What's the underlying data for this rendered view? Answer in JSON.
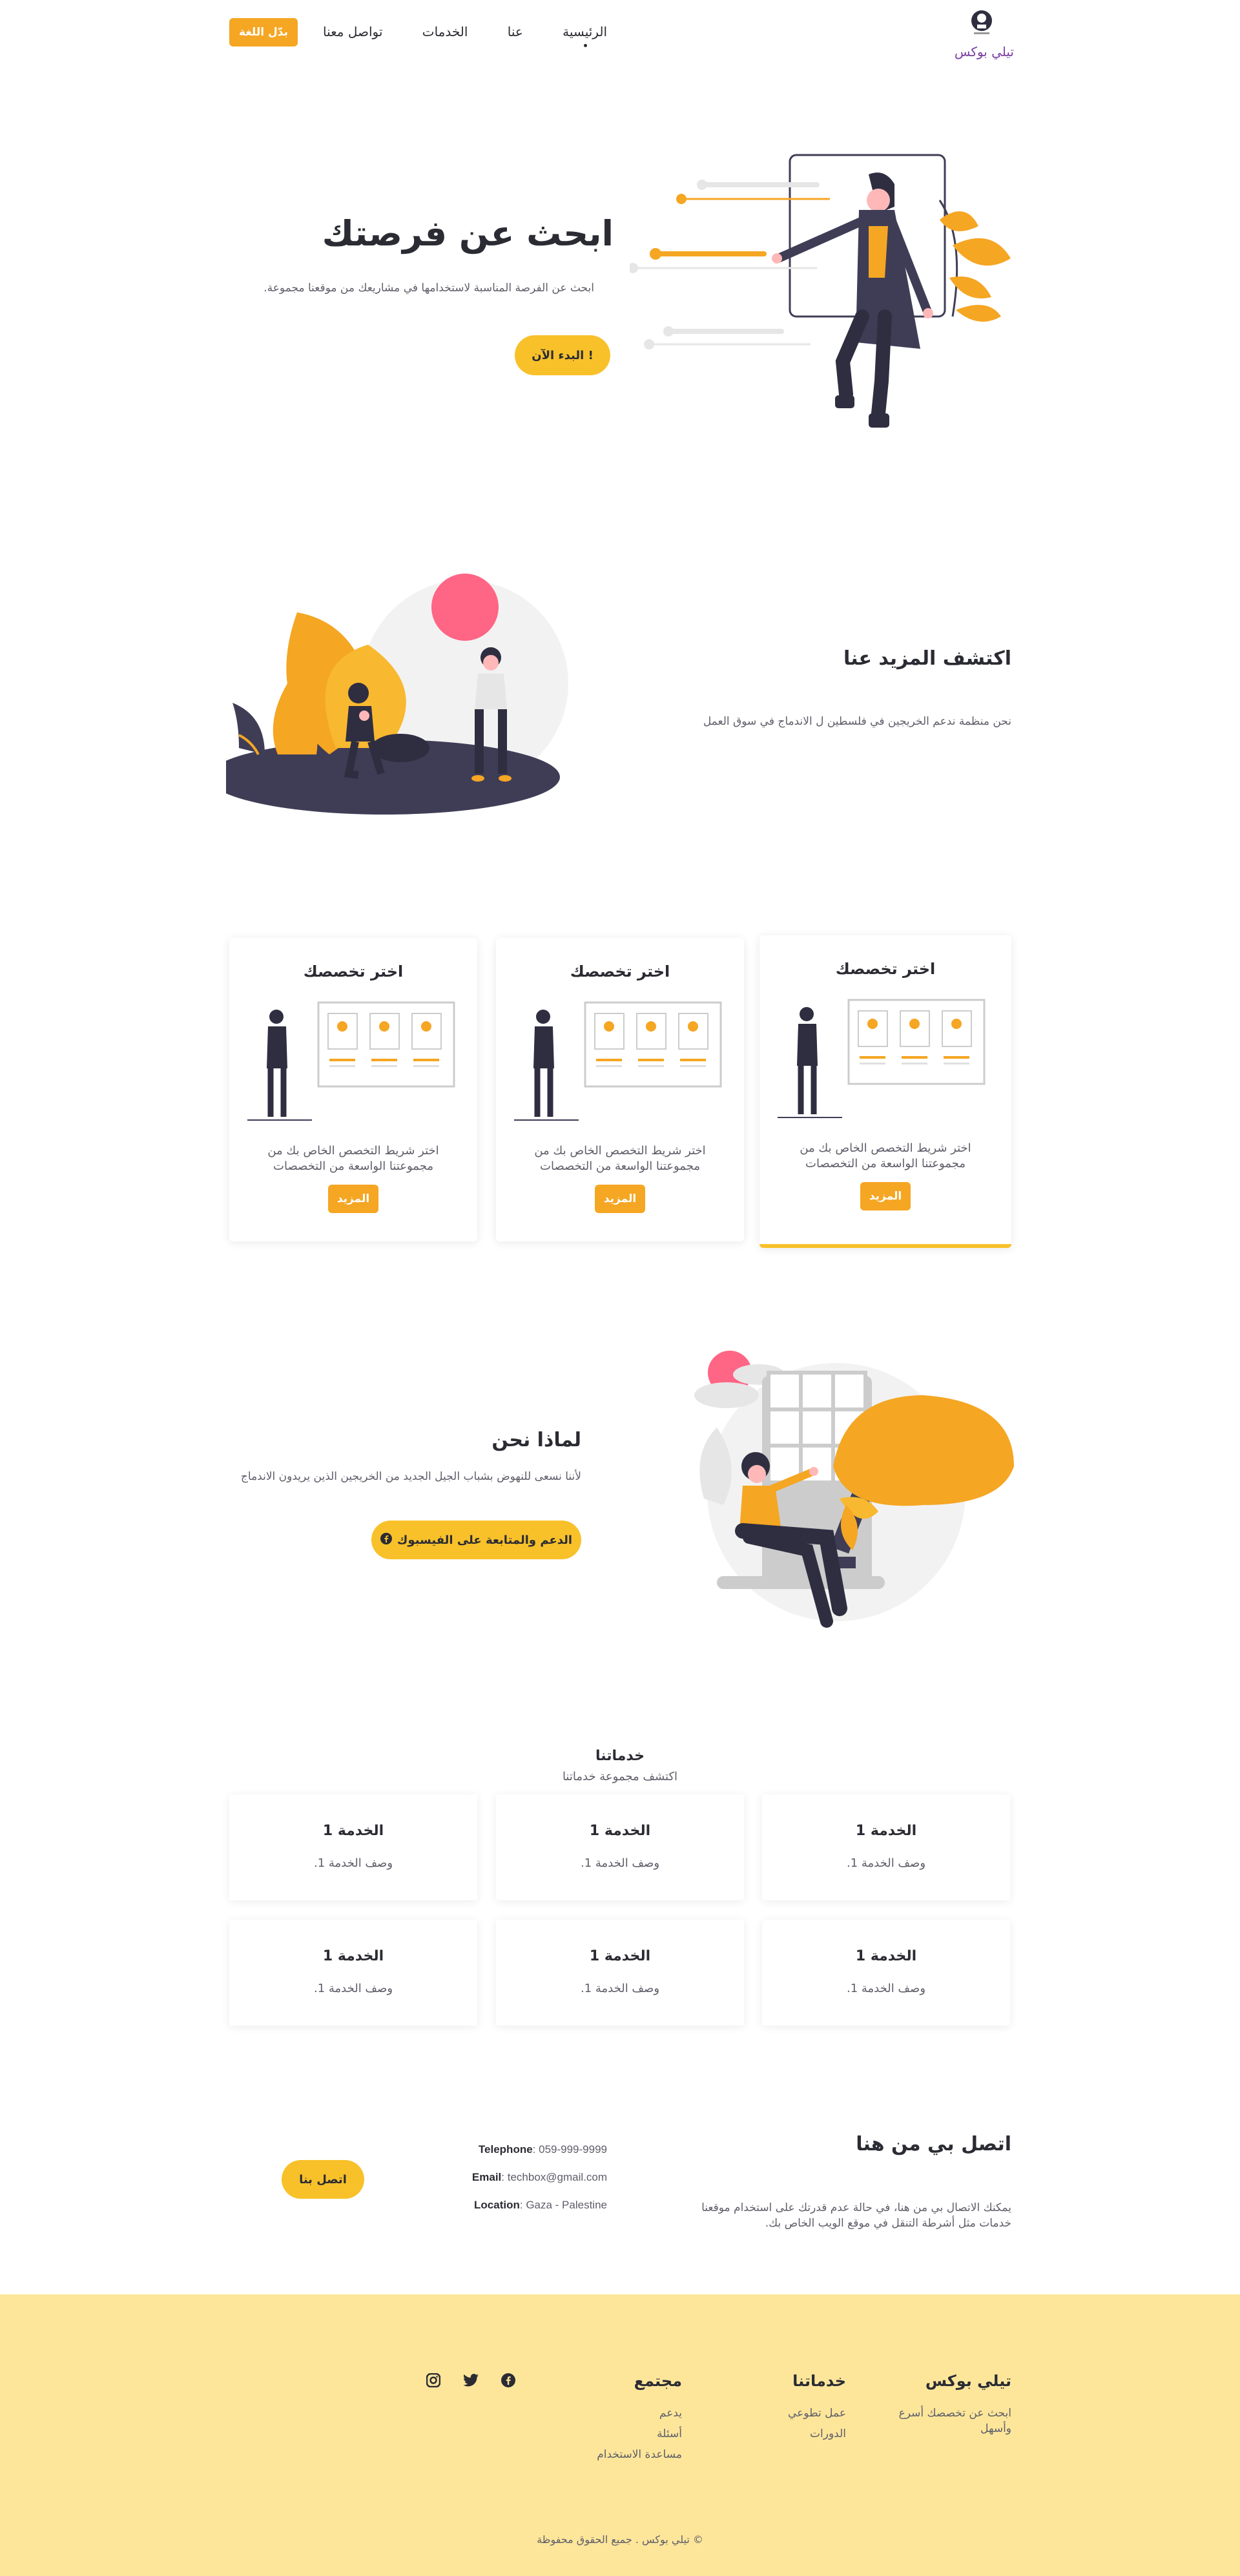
{
  "nav": {
    "brand": "تيلي بوكس",
    "links": [
      "الرئيسية",
      "عنا",
      "الخدمات",
      "تواصل معنا"
    ],
    "lang_button": "بدّل اللغة"
  },
  "hero": {
    "title": "ابحث عن فرصتك",
    "subtitle": "ابحث عن الفرصة المناسبة لاستخدامها في مشاريعك من موقعنا مجموعة.",
    "button": "! البدء الآن"
  },
  "about": {
    "title": "اكتشف المزيد عنا",
    "subtitle": "نحن منظمة ندعم الخريجين في فلسطين ل الاندماج في سوق العمل"
  },
  "cards": [
    {
      "title": "اختر تخصصك",
      "desc": "اختر شريط التخصص الخاص بك من مجموعتنا الواسعة من التخصصات",
      "button": "المزيد"
    },
    {
      "title": "اختر تخصصك",
      "desc": "اختر شريط التخصص الخاص بك من مجموعتنا الواسعة من التخصصات",
      "button": "المزيد"
    },
    {
      "title": "اختر تخصصك",
      "desc": "اختر شريط التخصص الخاص بك من مجموعتنا الواسعة من التخصصات",
      "button": "المزيد"
    }
  ],
  "why": {
    "title": "لماذا نحن",
    "subtitle": "لأننا نسعى للنهوض بشباب الجيل الجديد من الخريجين الذين يريدون الاندماج",
    "button": "الدعم والمتابعة على الفيسبوك"
  },
  "services": {
    "title": "خدماتنا",
    "subtitle": "اكتشف مجموعة خدماتنا",
    "items": [
      {
        "title": "الخدمة 1",
        "desc": "وصف الخدمة 1."
      },
      {
        "title": "الخدمة 1",
        "desc": "وصف الخدمة 1."
      },
      {
        "title": "الخدمة 1",
        "desc": "وصف الخدمة 1."
      },
      {
        "title": "الخدمة 1",
        "desc": "وصف الخدمة 1."
      },
      {
        "title": "الخدمة 1",
        "desc": "وصف الخدمة 1."
      },
      {
        "title": "الخدمة 1",
        "desc": "وصف الخدمة 1."
      }
    ]
  },
  "contact": {
    "title": "اتصل بي من هنا",
    "subtitle": "يمكنك الاتصال بي من هنا، في حالة عدم قدرتك على استخدام موقعنا خدمات مثل أشرطة التنقل في موقع الويب الخاص بك.",
    "telephone_label": "Telephone",
    "telephone": ": 059-999-9999",
    "email_label": "Email",
    "email": ": techbox@gmail.com",
    "location_label": "Location",
    "location": ": Gaza - Palestine",
    "button": "اتصل بنا"
  },
  "footer": {
    "brand_title": "تيلي بوكس",
    "brand_text": "ابحث عن تخصصك أسرع وأسهل",
    "services_title": "خدماتنا",
    "services_links": [
      "عمل تطوعي",
      "الدورات"
    ],
    "community_title": "مجتمع",
    "community_links": [
      "يدعم",
      "أسئلة",
      "مساعدة الاستخدام"
    ],
    "social_icons": [
      "facebook-icon",
      "twitter-icon",
      "instagram-icon"
    ],
    "copyright": "© تيلي بوكس . جميع الحقوق محفوظة"
  },
  "colors": {
    "accent_orange": "#f5a623",
    "accent_yellow": "#f8c12a",
    "footer_bg": "#fde69a",
    "brand_purple": "#7a3fa0",
    "dark": "#2f2e41",
    "pink": "#ff6584"
  }
}
